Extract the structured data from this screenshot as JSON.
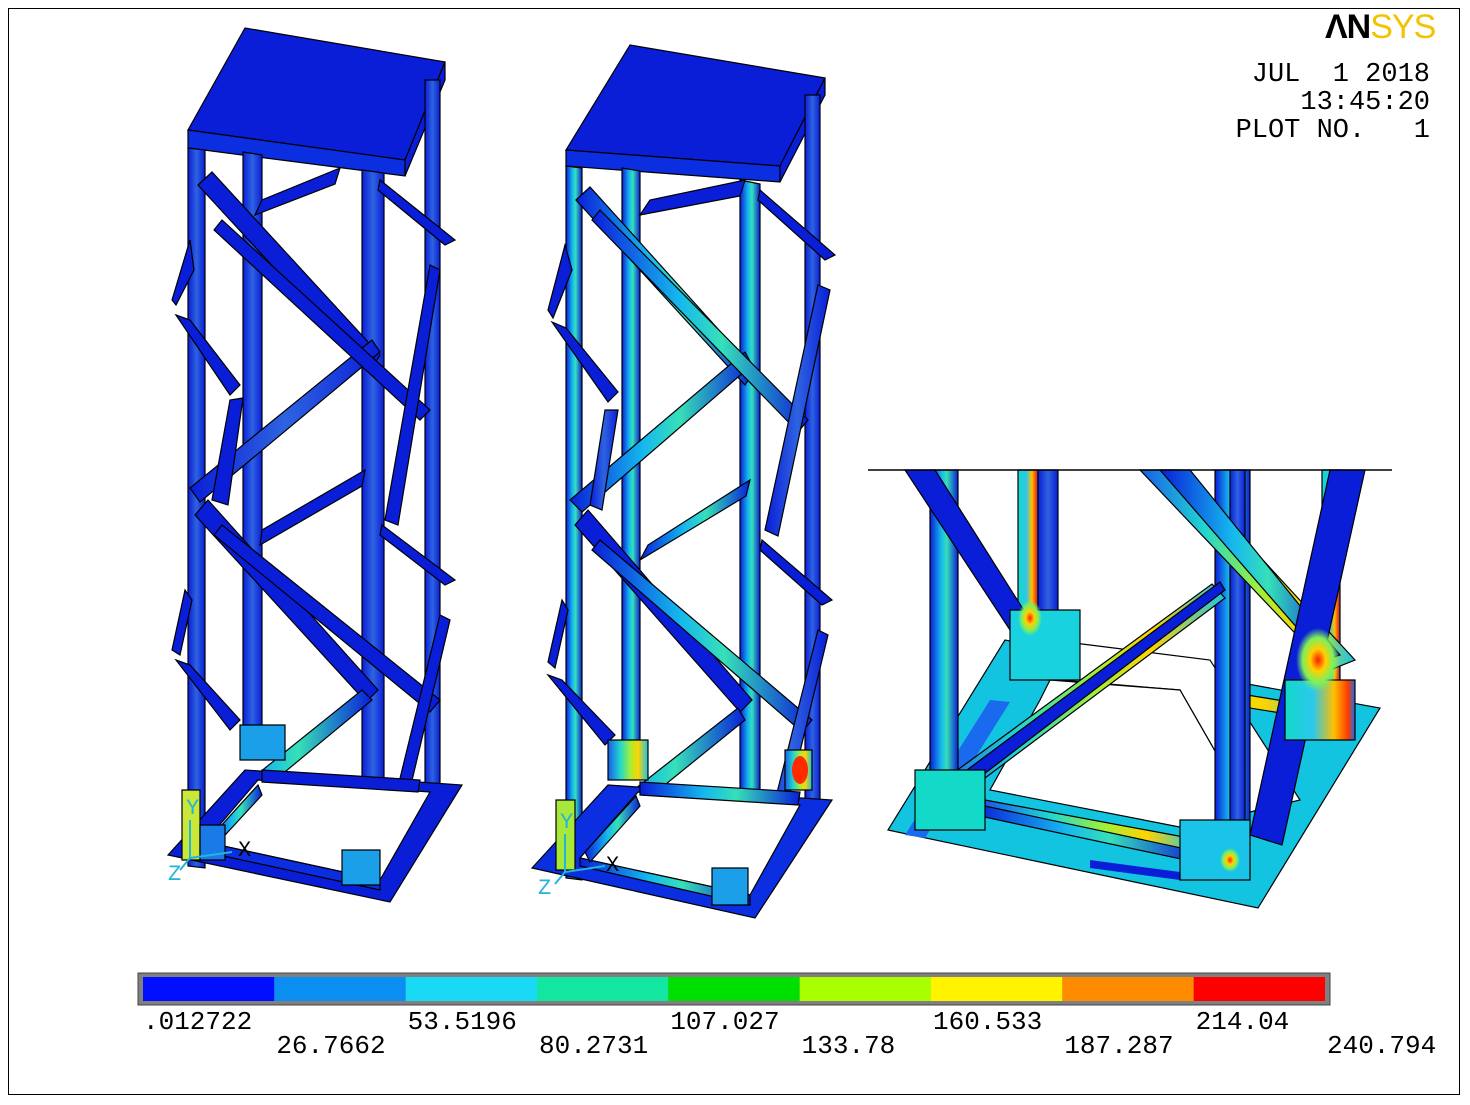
{
  "brand": {
    "logo_left": "ΛN",
    "logo_right": "SYS"
  },
  "header": {
    "date": "JUL  1 2018",
    "time": "13:45:20",
    "plot_label": "PLOT NO.   1"
  },
  "legend": {
    "colors": [
      "#0010ff",
      "#0a8ef2",
      "#19d9f4",
      "#12e6a0",
      "#00e000",
      "#a8ff00",
      "#fff300",
      "#ff8c00",
      "#ff0000"
    ],
    "ticks": [
      ".012722",
      "26.7662",
      "53.5196",
      "80.2731",
      "107.027",
      "133.78",
      "160.533",
      "187.287",
      "214.04",
      "240.794"
    ]
  },
  "axes": {
    "x": "X",
    "y": "Y",
    "z": "Z"
  },
  "colors": {
    "structure": "#0a1ed8",
    "outline": "#000000",
    "triad": "#23b5d8"
  }
}
